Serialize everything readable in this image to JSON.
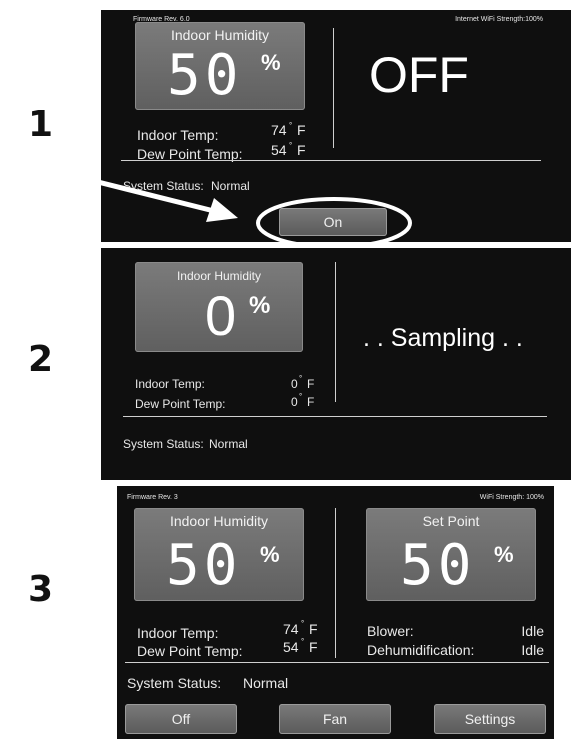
{
  "steps": [
    "1",
    "2",
    "3"
  ],
  "screen1": {
    "firmware": "Firmware Rev. 6.0",
    "wifi": "Internet WiFi Strength:100%",
    "humidity_label": "Indoor Humidity",
    "humidity_value": "50",
    "percent": "%",
    "mode_text": "OFF",
    "indoor_temp_label": "Indoor Temp:",
    "indoor_temp_value": "74",
    "dew_point_label": "Dew Point Temp:",
    "dew_point_value": "54",
    "unit": "F",
    "degree": "°",
    "status_label": "System Status:",
    "status_value": "Normal",
    "on_button": "On"
  },
  "screen2": {
    "humidity_label": "Indoor Humidity",
    "humidity_value": "0",
    "percent": "%",
    "mode_text": ". . Sampling . .",
    "indoor_temp_label": "Indoor Temp:",
    "indoor_temp_value": "0",
    "dew_point_label": "Dew Point Temp:",
    "dew_point_value": "0",
    "unit": "F",
    "degree": "°",
    "status_label": "System Status:",
    "status_value": "Normal"
  },
  "screen3": {
    "firmware": "Firmware Rev. 3",
    "wifi": "WiFi Strength: 100%",
    "humidity_label": "Indoor Humidity",
    "humidity_value": "50",
    "percent": "%",
    "setpoint_label": "Set Point",
    "setpoint_value": "50",
    "indoor_temp_label": "Indoor Temp:",
    "indoor_temp_value": "74",
    "dew_point_label": "Dew Point Temp:",
    "dew_point_value": "54",
    "unit": "F",
    "degree": "°",
    "blower_label": "Blower:",
    "blower_value": "Idle",
    "dehum_label": "Dehumidification:",
    "dehum_value": "Idle",
    "status_label": "System Status:",
    "status_value": "Normal",
    "buttons": [
      "Off",
      "Fan",
      "Settings"
    ]
  }
}
